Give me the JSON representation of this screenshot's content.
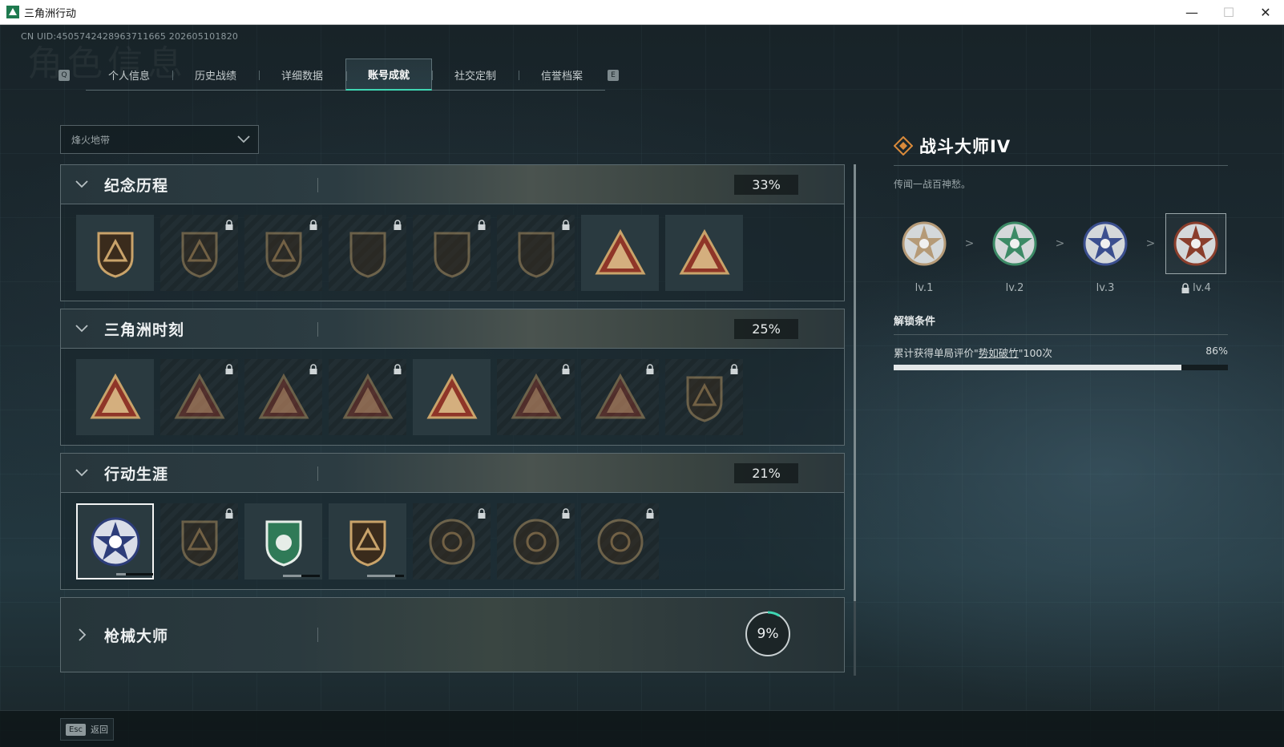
{
  "window": {
    "title": "三角洲行动",
    "minimize": "—",
    "maximize": "☐",
    "close": "✕"
  },
  "uid": "CN UID:4505742428963711665 202605101820",
  "bg_heading": "角色信息",
  "tabs": {
    "prev_key": "Q",
    "next_key": "E",
    "items": [
      {
        "label": "个人信息",
        "active": false
      },
      {
        "label": "历史战绩",
        "active": false
      },
      {
        "label": "详细数据",
        "active": false
      },
      {
        "label": "账号成就",
        "active": true
      },
      {
        "label": "社交定制",
        "active": false
      },
      {
        "label": "信誉档案",
        "active": false
      }
    ]
  },
  "mode_select": {
    "value": "烽火地带"
  },
  "categories": [
    {
      "title": "纪念历程",
      "percent": "33%",
      "badges": [
        {
          "icon": "shield-delta-emblem-icon",
          "locked": false
        },
        {
          "icon": "helicopter-emblem-icon",
          "locked": true
        },
        {
          "icon": "crest-emblem-icon",
          "locked": true
        },
        {
          "icon": "skull-wings-emblem-icon",
          "locked": true
        },
        {
          "icon": "hooded-figure-emblem-icon",
          "locked": true
        },
        {
          "icon": "crossed-blades-emblem-icon",
          "locked": true
        },
        {
          "icon": "triangle-wave-emblem-icon",
          "locked": false
        },
        {
          "icon": "triangle-number-one-emblem-icon",
          "locked": false
        }
      ]
    },
    {
      "title": "三角洲时刻",
      "percent": "25%",
      "badges": [
        {
          "icon": "triangle-crate-emblem-icon",
          "locked": false
        },
        {
          "icon": "triangle-figure-emblem-icon",
          "locked": true
        },
        {
          "icon": "triangle-runner-emblem-icon",
          "locked": true
        },
        {
          "icon": "triangle-circle-emblem-icon",
          "locked": true
        },
        {
          "icon": "triangle-team-emblem-icon",
          "locked": false
        },
        {
          "icon": "triangle-warrior-emblem-icon",
          "locked": true
        },
        {
          "icon": "triangle-serpent-emblem-icon",
          "locked": true
        },
        {
          "icon": "diamond-crest-emblem-icon",
          "locked": true
        }
      ]
    },
    {
      "title": "行动生涯",
      "percent": "21%",
      "badges": [
        {
          "icon": "star-wreath-emblem-icon",
          "locked": false,
          "selected": true,
          "progress": 0.25
        },
        {
          "icon": "chevron-shield-emblem-icon",
          "locked": true
        },
        {
          "icon": "green-shield-emblem-icon",
          "locked": false,
          "progress": 0.5
        },
        {
          "icon": "gem-shield-emblem-icon",
          "locked": false,
          "progress": 0.75
        },
        {
          "icon": "ring-emblem-icon",
          "locked": true
        },
        {
          "icon": "target-emblem-icon",
          "locked": true
        },
        {
          "icon": "eye-emblem-icon",
          "locked": true
        }
      ]
    }
  ],
  "collapsed_category": {
    "title": "枪械大师",
    "percent": "9%",
    "progress": 0.09
  },
  "detail": {
    "title": "战斗大师IV",
    "description": "传闻一战百神愁。",
    "levels": [
      {
        "label": "lv.1",
        "icon": "bronze-star-medal-icon",
        "color": "#b59a77"
      },
      {
        "label": "lv.2",
        "icon": "green-star-medal-icon",
        "color": "#3c8a66"
      },
      {
        "label": "lv.3",
        "icon": "blue-star-medal-icon",
        "color": "#3b4f8f"
      },
      {
        "label": "lv.4",
        "icon": "red-star-medal-icon",
        "color": "#8a3e2c",
        "locked": true,
        "current": true
      }
    ],
    "arrow": ">",
    "unlock_title": "解锁条件",
    "condition": {
      "prefix": "累计获得单局评价\"",
      "highlight": "势如破竹",
      "suffix": "\"100次",
      "percent_label": "86%",
      "progress": 0.86
    }
  },
  "bottom": {
    "esc_key": "Esc",
    "esc_label": "返回"
  },
  "colors": {
    "accent": "#3fd6b3",
    "gold": "#c9a36a",
    "selected_border": "#f2f4f4"
  }
}
